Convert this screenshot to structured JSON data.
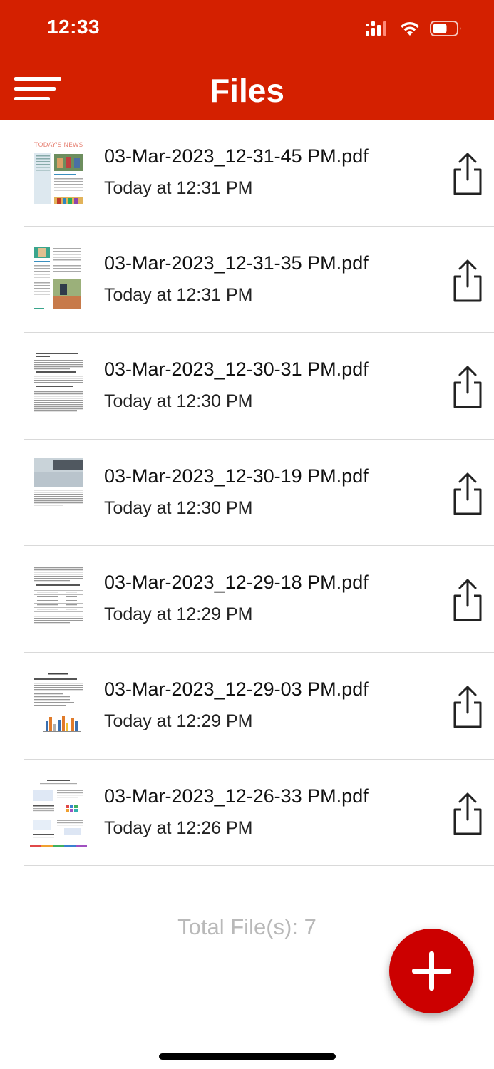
{
  "status_bar": {
    "time": "12:33"
  },
  "header": {
    "title": "Files"
  },
  "files": [
    {
      "name": "03-Mar-2023_12-31-45 PM.pdf",
      "date": "Today at 12:31 PM"
    },
    {
      "name": "03-Mar-2023_12-31-35 PM.pdf",
      "date": "Today at 12:31 PM"
    },
    {
      "name": "03-Mar-2023_12-30-31 PM.pdf",
      "date": "Today at 12:30 PM"
    },
    {
      "name": "03-Mar-2023_12-30-19 PM.pdf",
      "date": "Today at 12:30 PM"
    },
    {
      "name": "03-Mar-2023_12-29-18 PM.pdf",
      "date": "Today at 12:29 PM"
    },
    {
      "name": "03-Mar-2023_12-29-03 PM.pdf",
      "date": "Today at 12:29 PM"
    },
    {
      "name": "03-Mar-2023_12-26-33 PM.pdf",
      "date": "Today at 12:26 PM"
    }
  ],
  "footer": {
    "total_label": "Total File(s): 7"
  },
  "icons": {
    "menu": "hamburger-menu-icon",
    "share": "share-icon",
    "add": "plus-icon",
    "signal": "cellular-signal-icon",
    "wifi": "wifi-icon",
    "battery": "battery-icon"
  },
  "colors": {
    "header": "#D42000",
    "fab": "#CC0000",
    "total_text": "#B9B9B9"
  }
}
